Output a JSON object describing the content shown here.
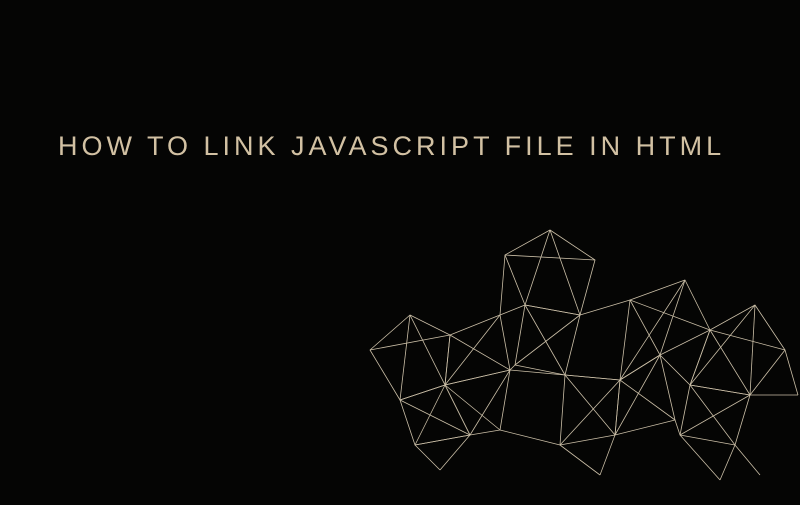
{
  "title": "HOW TO LINK JAVASCRIPT FILE IN HTML"
}
